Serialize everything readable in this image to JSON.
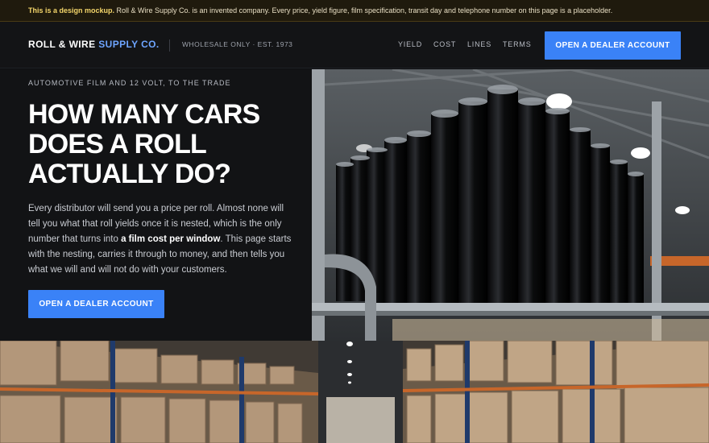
{
  "notice": {
    "lead": "This is a design mockup.",
    "text": " Roll & Wire Supply Co. is an invented company. Every price, yield figure, film specification, transit day and telephone number on this page is a placeholder."
  },
  "header": {
    "brand_main": "ROLL & WIRE ",
    "brand_accent": "SUPPLY CO.",
    "tagline": "WHOLESALE ONLY · EST. 1973",
    "nav": [
      "YIELD",
      "COST",
      "LINES",
      "TERMS"
    ],
    "cta": "OPEN A DEALER ACCOUNT"
  },
  "hero": {
    "eyebrow": "AUTOMOTIVE FILM AND 12 VOLT, TO THE TRADE",
    "headline": "HOW MANY CARS DOES A ROLL ACTUALLY DO?",
    "lede_before": "Every distributor will send you a price per roll. Almost none will tell you what that roll yields once it is nested, which is the only number that turns into ",
    "lede_bold": "a film cost per window",
    "lede_after": ". This page starts with the nesting, carries it through to money, and then tells you what we will and will not do with your customers.",
    "cta": "OPEN A DEALER ACCOUNT"
  },
  "colors": {
    "accent": "#3a82f7",
    "brand_accent": "#6ea5ff",
    "notice_bg": "#1f1a0d",
    "notice_lead": "#f3d56a"
  }
}
